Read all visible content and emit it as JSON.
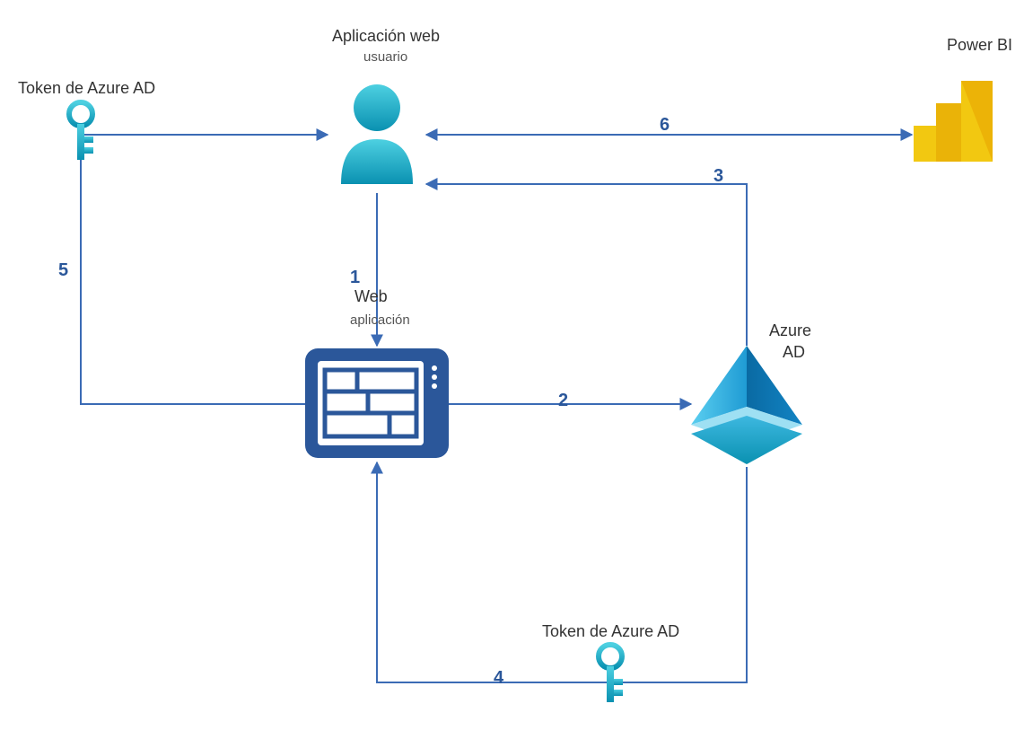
{
  "nodes": {
    "token_left": {
      "label": "Token de Azure AD"
    },
    "user": {
      "title": "Aplicación web",
      "subtitle": "usuario"
    },
    "web_app": {
      "title": "Web",
      "subtitle": "aplicación"
    },
    "azure_ad": {
      "title": "Azure",
      "subtitle": "AD"
    },
    "token_bottom": {
      "label": "Token de Azure AD"
    },
    "power_bi": {
      "title": "Power BI"
    }
  },
  "edges": {
    "e1": "1",
    "e2": "2",
    "e3": "3",
    "e4": "4",
    "e5": "5",
    "e6": "6"
  },
  "colors": {
    "line": "#3b6bb5",
    "accent": "#2bb2d5",
    "accent_dark": "#0a91b1",
    "web_blue": "#2b579a",
    "aad_light": "#4dc6ea",
    "aad_mid": "#1f9bd4",
    "aad_dark": "#0a6aa3",
    "pbi_yellow": "#f2c811",
    "pbi_orange": "#e8a200"
  }
}
